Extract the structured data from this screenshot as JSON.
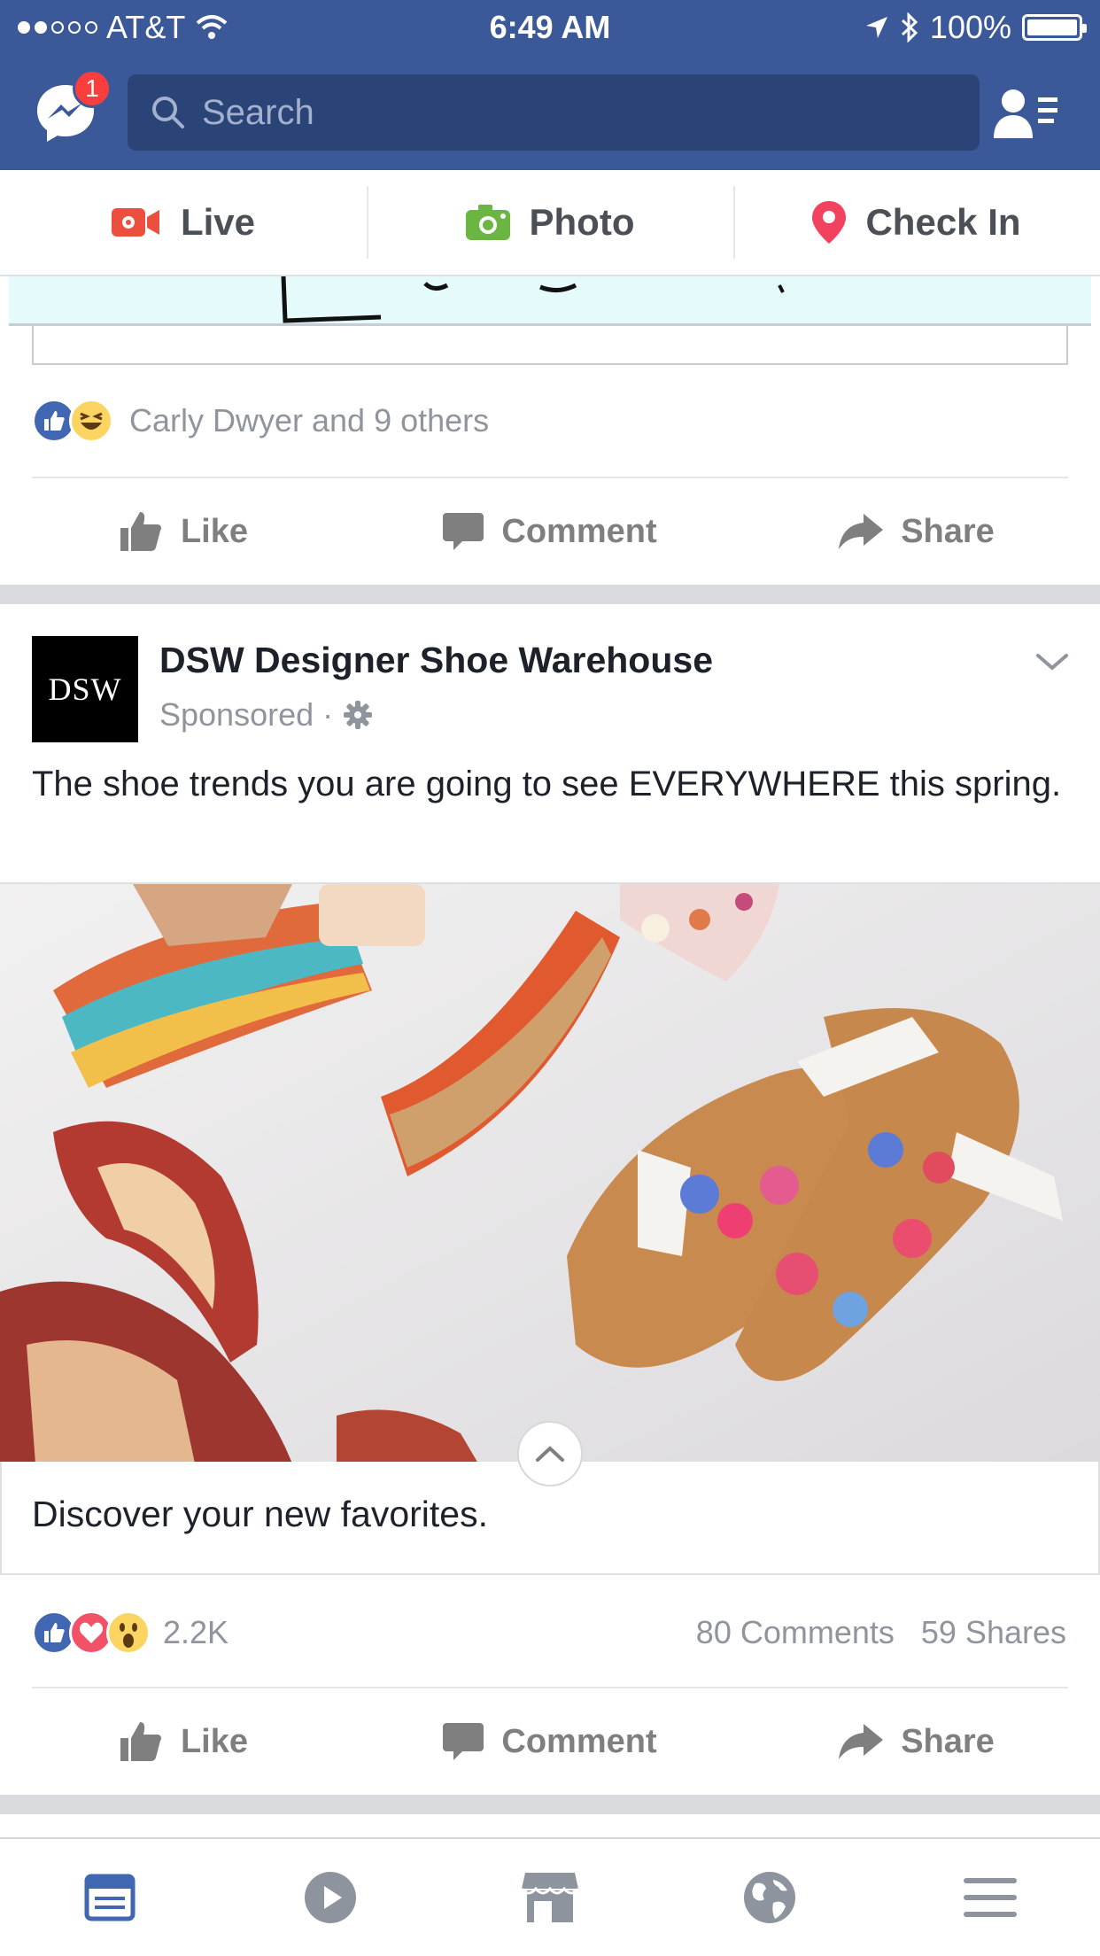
{
  "status_bar": {
    "carrier": "AT&T",
    "time": "6:49 AM",
    "battery": "100%"
  },
  "header": {
    "messenger_badge": "1",
    "search_placeholder": "Search"
  },
  "composer": {
    "live": "Live",
    "photo": "Photo",
    "check_in": "Check In"
  },
  "previous_post": {
    "reactions_text": "Carly Dwyer and 9 others",
    "actions": {
      "like": "Like",
      "comment": "Comment",
      "share": "Share"
    }
  },
  "sponsored_post": {
    "logo_text": "DSW",
    "page_name": "DSW Designer Shoe Warehouse",
    "sponsored_label": "Sponsored ·",
    "text": "The shoe trends you are going to see EVERYWHERE this spring.",
    "caption": "Discover your new favorites.",
    "reaction_count": "2.2K",
    "comments": "80 Comments",
    "shares": "59 Shares",
    "actions": {
      "like": "Like",
      "comment": "Comment",
      "share": "Share"
    }
  },
  "colors": {
    "brand": "#3b5998",
    "like_blue": "#4267b2",
    "love_red": "#f25268",
    "icon_grey": "#7f7f7f"
  },
  "icons": [
    "messenger-icon",
    "search-icon",
    "friend-requests-icon",
    "live-video-icon",
    "camera-icon",
    "location-pin-icon",
    "like-reaction-icon",
    "haha-reaction-icon",
    "love-reaction-icon",
    "wow-reaction-icon",
    "thumbs-up-icon",
    "comment-icon",
    "share-arrow-icon",
    "chevron-down-icon",
    "gear-icon",
    "chevron-up-icon",
    "news-feed-icon",
    "video-icon",
    "marketplace-icon",
    "notifications-globe-icon",
    "menu-icon"
  ]
}
